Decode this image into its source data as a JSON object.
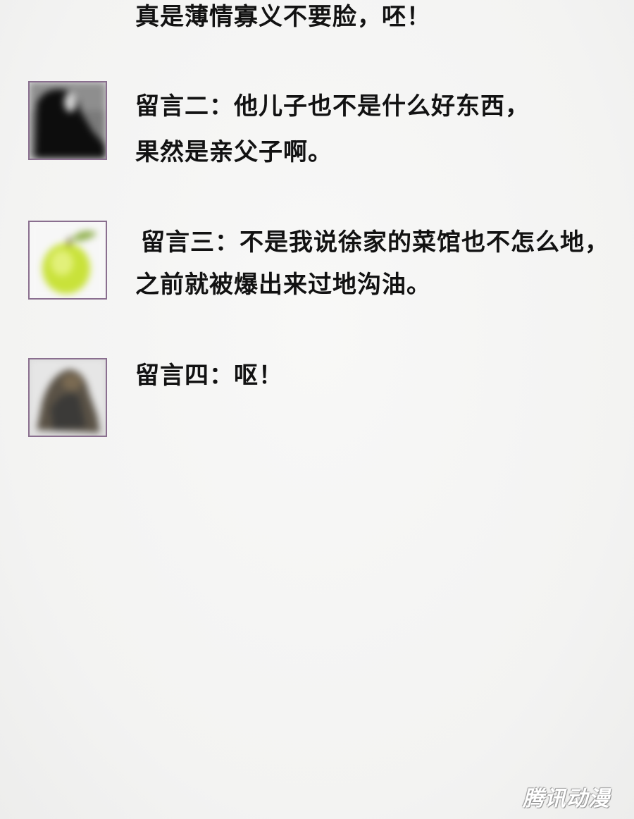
{
  "page": {
    "top_text": "真是薄情寡义不要脸，呸！",
    "comments": [
      {
        "avatar_icon": "dark-portrait-avatar",
        "lines": [
          "留言二：他儿子也不是什么好东西，",
          "果然是亲父子啊。"
        ]
      },
      {
        "avatar_icon": "green-apple-avatar",
        "lines": [
          "留言三：不是我说徐家的菜馆也不怎么地，",
          "之前就被爆出来过地沟油。"
        ]
      },
      {
        "avatar_icon": "rocky-figure-avatar",
        "lines": [
          "留言四：呕！"
        ]
      }
    ],
    "watermark": "腾讯动漫"
  },
  "colors": {
    "background": "#f4f4f3",
    "text": "#121212",
    "avatar_border": "#8a6f8f",
    "apple_green": "#c9e23a"
  }
}
